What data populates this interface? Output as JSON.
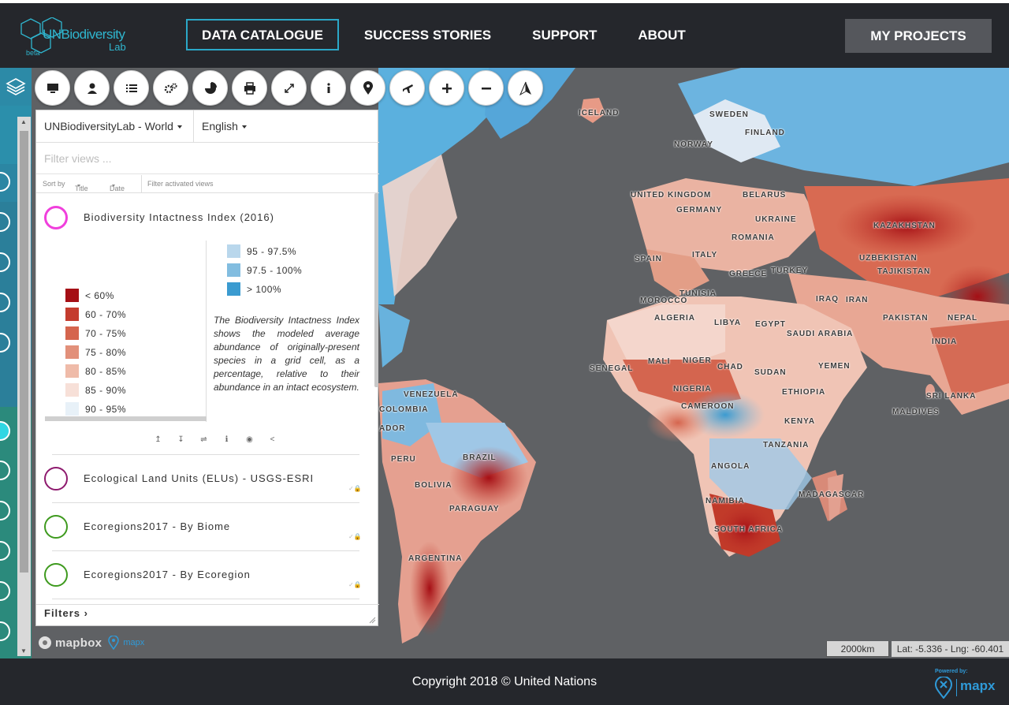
{
  "header": {
    "logo_main": "UNBiodiversity",
    "logo_sub": "Lab",
    "logo_badge": "beta",
    "nav": [
      "DATA CATALOGUE",
      "SUCCESS STORIES",
      "SUPPORT",
      "ABOUT"
    ],
    "active_nav": "DATA CATALOGUE",
    "my_projects": "MY PROJECTS"
  },
  "toolbar": {
    "icons": [
      "desktop-icon",
      "user-icon",
      "list-icon",
      "cogs-icon",
      "pie-chart-icon",
      "print-icon",
      "expand-icon",
      "info-icon",
      "map-marker-icon",
      "plane-icon",
      "plus-icon",
      "minus-icon",
      "compass-arrow-icon"
    ]
  },
  "panel": {
    "workspace": "UNBiodiversityLab - World",
    "language": "English",
    "filter_placeholder": "Filter views ...",
    "sort_by": "Sort by",
    "sort_title": "Title",
    "sort_date": "Date",
    "filter_activated": "Filter activated views",
    "active_layer": {
      "title": "Biodiversity Intactness Index (2016)",
      "ring_color": "#f03fdc",
      "legend_left": [
        {
          "label": "< 60%",
          "color": "#a50f15"
        },
        {
          "label": "60 - 70%",
          "color": "#c43c2e"
        },
        {
          "label": "70 - 75%",
          "color": "#d5654e"
        },
        {
          "label": "75 - 80%",
          "color": "#e2907a"
        },
        {
          "label": "80 - 85%",
          "color": "#efbba9"
        },
        {
          "label": "85 - 90%",
          "color": "#f7e0d8"
        },
        {
          "label": "90 - 95%",
          "color": "#e8f1f8"
        }
      ],
      "legend_right": [
        {
          "label": "95 - 97.5%",
          "color": "#b9d7ec"
        },
        {
          "label": "97.5 - 100%",
          "color": "#82bde0"
        },
        {
          "label": "> 100%",
          "color": "#3b9bd0"
        }
      ],
      "description": "The Biodiversity Intactness Index shows the modeled average abundance of originally-present species in a grid cell, as a percentage, relative to their abundance in an intact ecosystem.",
      "tools": [
        "↥",
        "↧",
        "⇌",
        "ℹ",
        "◉",
        "<"
      ]
    },
    "layers": [
      {
        "title": "Ecological Land Units (ELUs) - USGS-ESRI",
        "ring_color": "#8e1a6e"
      },
      {
        "title": "Ecoregions2017 - By Biome",
        "ring_color": "#3e9a1e"
      },
      {
        "title": "Ecoregions2017 - By Ecoregion",
        "ring_color": "#3e9a1e"
      }
    ],
    "filters_link": "Filters ›"
  },
  "map": {
    "countries": [
      "ICELAND",
      "SWEDEN",
      "FINLAND",
      "NORWAY",
      "UNITED KINGDOM",
      "BELARUS",
      "GERMANY",
      "UKRAINE",
      "ROMANIA",
      "KAZAKHSTAN",
      "UZBEKISTAN",
      "TAJIKISTAN",
      "SPAIN",
      "ITALY",
      "GREECE",
      "TURKEY",
      "IRAQ",
      "IRAN",
      "PAKISTAN",
      "NEPAL",
      "INDIA",
      "MOROCCO",
      "TUNISIA",
      "ALGERIA",
      "LIBYA",
      "EGYPT",
      "SAUDI ARABIA",
      "YEMEN",
      "MALI",
      "NIGER",
      "CHAD",
      "SUDAN",
      "SENEGAL",
      "NIGERIA",
      "ETHIOPIA",
      "CAMEROON",
      "KENYA",
      "TANZANIA",
      "SRI LANKA",
      "MALDIVES",
      "ANGOLA",
      "NAMIBIA",
      "SOUTH AFRICA",
      "MADAGASCAR",
      "VENEZUELA",
      "COLOMBIA",
      "ADOR",
      "PERU",
      "BRAZIL",
      "BOLIVIA",
      "PARAGUAY",
      "ARGENTINA"
    ],
    "scale": "2000km",
    "latlng": "Lat: -5.336 - Lng: -60.401",
    "attribution_mapbox": "mapbox",
    "attribution_mapx": "mapx"
  },
  "footer": {
    "copyright": "Copyright 2018 © United Nations",
    "powered_by": "Powered by:",
    "mapx": "mapx"
  }
}
